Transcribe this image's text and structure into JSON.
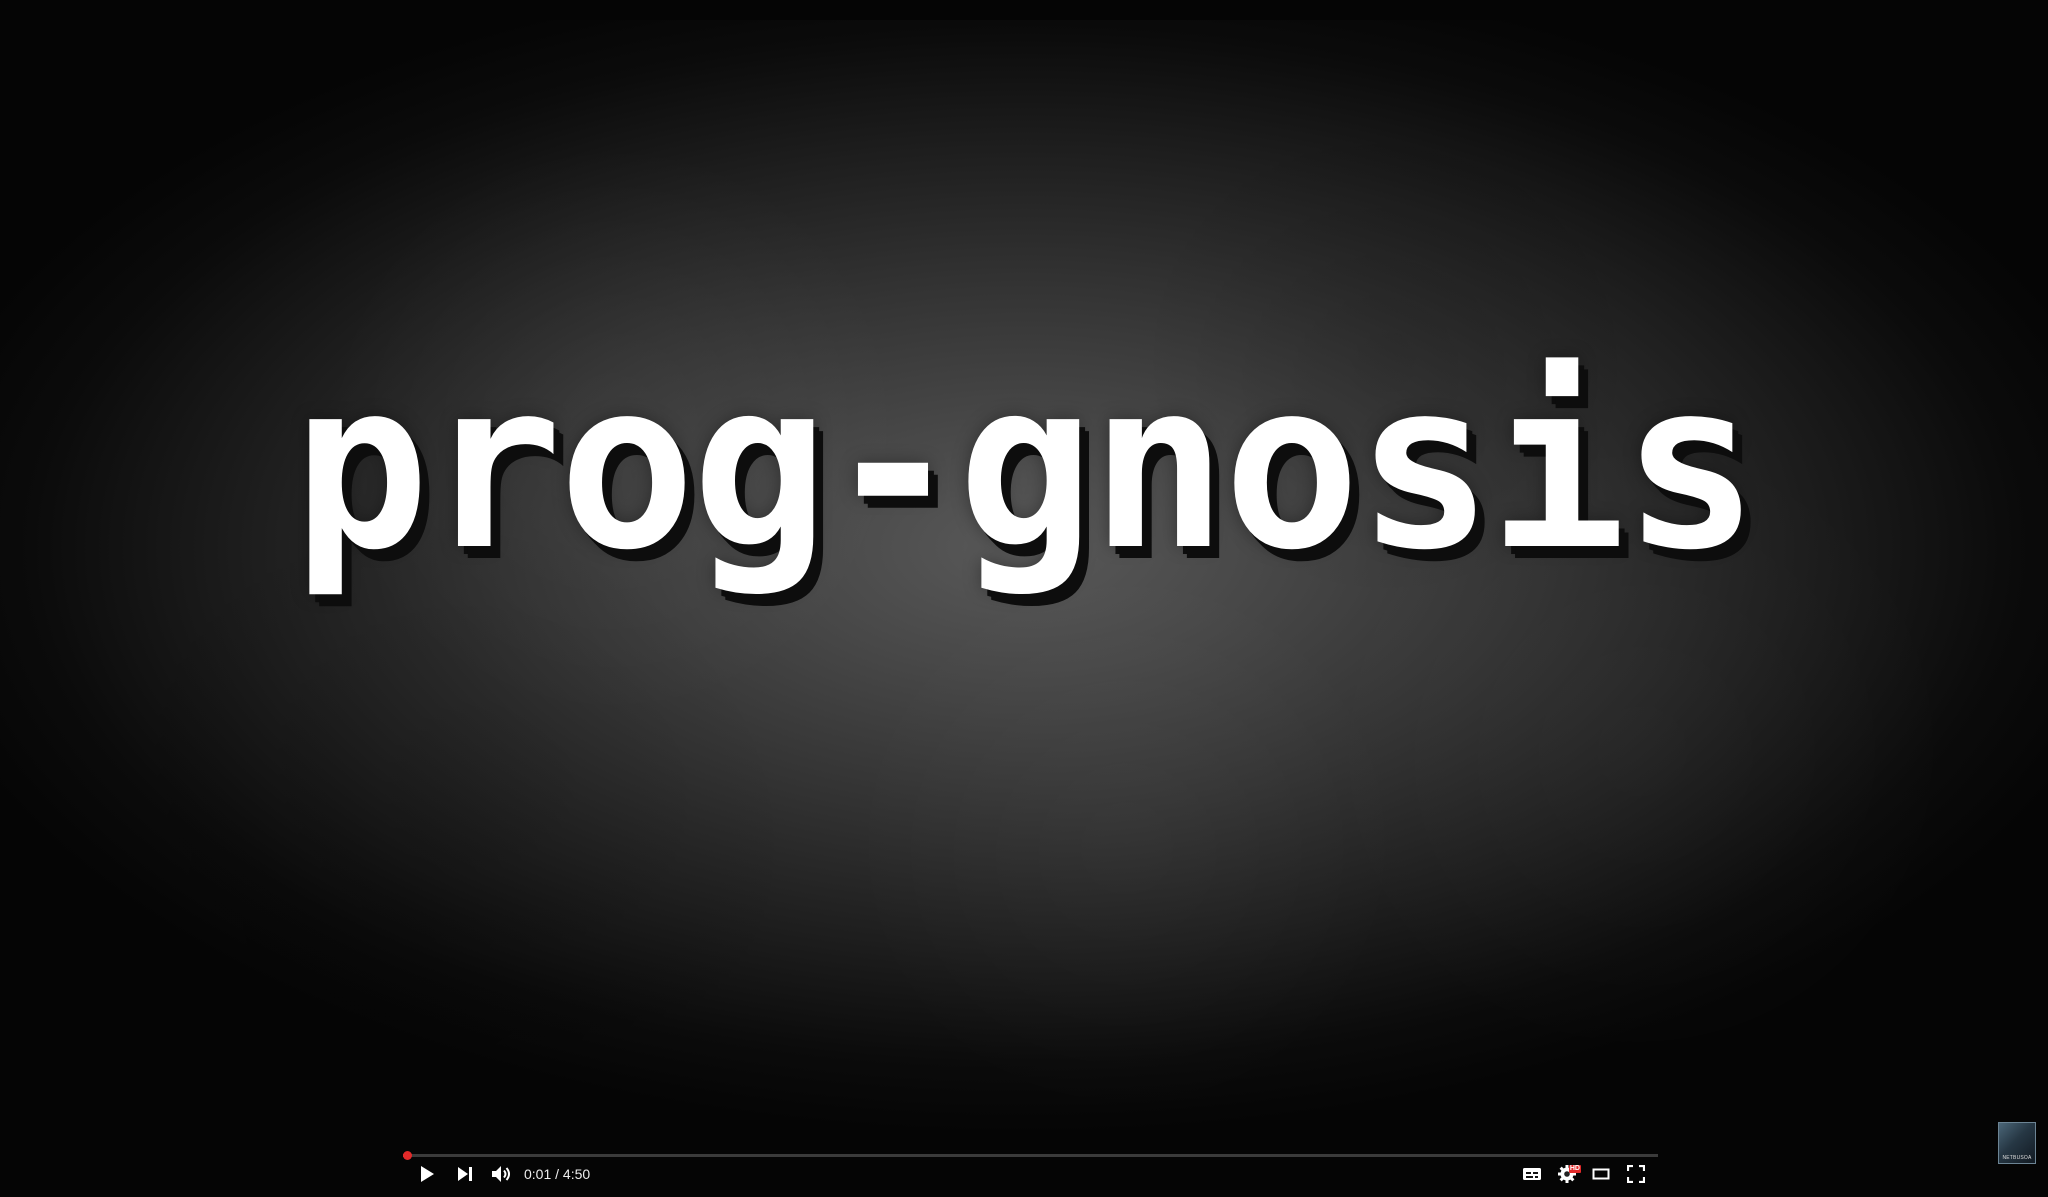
{
  "video": {
    "title_card_text": "prog-gnosis",
    "channel_watermark_text": "NETBUSOA"
  },
  "player": {
    "current_time": "0:01",
    "duration": "4:50",
    "time_display": "0:01 / 4:50",
    "progress_fraction": 0.0035,
    "hd_badge": "HD",
    "accent_color": "#e22a2a",
    "icons": {
      "play": "play-icon",
      "next": "next-icon",
      "volume": "volume-icon",
      "captions": "captions-icon",
      "settings": "settings-gear-icon",
      "theater": "theater-mode-icon",
      "fullscreen": "fullscreen-icon"
    }
  }
}
